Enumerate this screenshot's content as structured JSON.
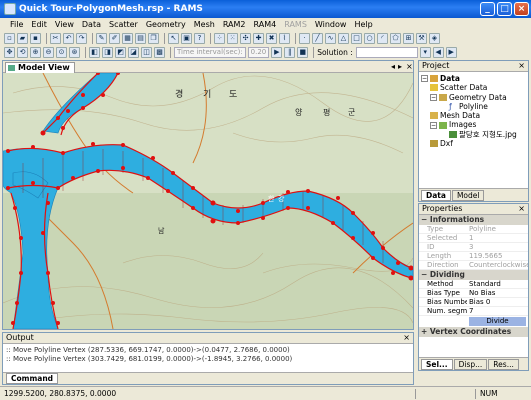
{
  "window": {
    "title": "Quick Tour-PolygonMesh.rsp - RAMS"
  },
  "menu": [
    {
      "label": "File",
      "enabled": true
    },
    {
      "label": "Edit",
      "enabled": true
    },
    {
      "label": "View",
      "enabled": true
    },
    {
      "label": "Data",
      "enabled": true
    },
    {
      "label": "Scatter",
      "enabled": true
    },
    {
      "label": "Geometry",
      "enabled": true
    },
    {
      "label": "Mesh",
      "enabled": true
    },
    {
      "label": "RAM2",
      "enabled": true
    },
    {
      "label": "RAM4",
      "enabled": true
    },
    {
      "label": "RAMS",
      "enabled": false
    },
    {
      "label": "Window",
      "enabled": true
    },
    {
      "label": "Help",
      "enabled": true
    }
  ],
  "toolbar2": {
    "time_interval_label": "Time interval(sec):",
    "time_interval_value": "0.20",
    "solution_label": "Solution :"
  },
  "model_view": {
    "tab_label": "Model View",
    "map_labels": [
      "경",
      "기",
      "도",
      "양",
      "평",
      "군",
      "남",
      "한",
      "강"
    ]
  },
  "project": {
    "header": "Project",
    "tree": {
      "root": "Data",
      "scatter": "Scatter Data",
      "geometry": "Geometry Data",
      "polyline": "Polyline",
      "mesh": "Mesh Data",
      "images": "Images",
      "image_file": "팔당호 지형도.jpg",
      "dxf": "Dxf"
    },
    "tabs": [
      "Data",
      "Model"
    ]
  },
  "properties": {
    "header": "Properties",
    "sections": {
      "informations": "Informations",
      "dividing": "Dividing",
      "vertex": "Vertex Coordinates"
    },
    "info_rows": [
      {
        "key": "Type",
        "value": "Polyline"
      },
      {
        "key": "Selected",
        "value": "1"
      },
      {
        "key": "ID",
        "value": "3"
      },
      {
        "key": "Length",
        "value": "119.5665"
      },
      {
        "key": "Direction",
        "value": "Counterclockwise"
      }
    ],
    "dividing_rows": [
      {
        "key": "Method",
        "value": "Standard"
      },
      {
        "key": "Bias Type",
        "value": "No Bias"
      },
      {
        "key": "Bias Number",
        "value": "Bias 0"
      },
      {
        "key": "Num. segments",
        "value": "7"
      }
    ],
    "divide_button": "Divide",
    "tabs": [
      "Sel...",
      "Disp...",
      "Res..."
    ]
  },
  "output": {
    "header": "Output",
    "lines": [
      ":: Move Polyline Vertex (287.5336, 669.1747, 0.0000)->(0.0477, 2.7686, 0.0000)",
      ":: Move Polyline Vertex (303.7429, 681.0199, 0.0000)->(-1.8945, 3.2766, 0.0000)"
    ],
    "tab": "Command"
  },
  "status": {
    "coords": "1299.5200, 280.8375, 0.0000",
    "num": "NUM"
  },
  "colors": {
    "titlebar": "#0a5fd8",
    "river": "#2eaee0",
    "polyline": "#e01010",
    "mesh_line": "#9a1f1f"
  }
}
